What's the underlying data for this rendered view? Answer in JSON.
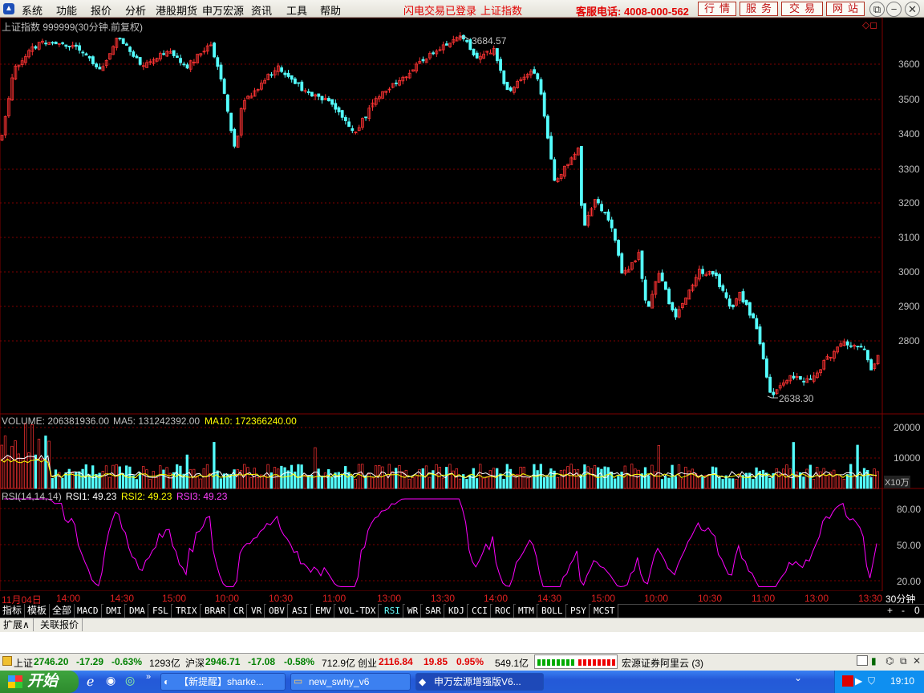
{
  "menu": [
    "系统",
    "功能",
    "报价",
    "分析",
    "港股期货",
    "申万宏源",
    "资讯",
    "工具",
    "帮助"
  ],
  "notice1": "闪电交易已登录",
  "notice2": "上证指数",
  "hotline": "客服电话: 4008-000-562",
  "topbuttons": [
    "行情",
    "服务",
    "交易",
    "网站"
  ],
  "chart_header": "上证指数 999999(30分钟.前复权)",
  "price_axis": [
    "3600",
    "3500",
    "3400",
    "3300",
    "3200",
    "3100",
    "3000",
    "2900",
    "2800"
  ],
  "high_label": "3684.57",
  "low_label": "2638.30",
  "volume": {
    "label": "VOLUME:",
    "value": "206381936.00",
    "ma5_label": "MA5:",
    "ma5": "131242392.00",
    "ma10_label": "MA10:",
    "ma10": "172366240.00",
    "axis": [
      "20000",
      "10000"
    ],
    "unit": "X10万"
  },
  "rsi": {
    "label": "RSI(14,14,14)",
    "rsi1": "RSI1: 49.23",
    "rsi2": "RSI2: 49.23",
    "rsi3": "RSI3: 49.23",
    "axis": [
      "80.00",
      "50.00",
      "20.00"
    ]
  },
  "time_axis": [
    "11月04日",
    "14:00",
    "14:30",
    "15:00",
    "10:00",
    "10:30",
    "11:00",
    "13:00",
    "13:30",
    "14:00",
    "14:30",
    "15:00",
    "10:00",
    "10:30",
    "11:00",
    "13:00",
    "13:30"
  ],
  "period": "30分钟",
  "tabs": [
    "指标",
    "模板",
    "全部",
    "MACD",
    "DMI",
    "DMA",
    "FSL",
    "TRIX",
    "BRAR",
    "CR",
    "VR",
    "OBV",
    "ASI",
    "EMV",
    "VOL-TDX",
    "RSI",
    "WR",
    "SAR",
    "KDJ",
    "CCI",
    "ROC",
    "MTM",
    "BOLL",
    "PSY",
    "MCST"
  ],
  "tab_controls": [
    "+",
    "-",
    "0"
  ],
  "ext_tabs": [
    "扩展∧",
    "关联报价"
  ],
  "status": {
    "sh_label": "上证",
    "sh_val": "2746.20",
    "sh_chg": "-17.29",
    "sh_pct": "-0.63%",
    "sh_amt": "1293亿",
    "hs_label": "沪深",
    "hs_val": "2946.71",
    "hs_chg": "-17.08",
    "hs_pct": "-0.58%",
    "hs_amt": "712.9亿",
    "cy_label": "创业",
    "cy_val": "2116.84",
    "cy_chg": "19.85",
    "cy_pct": "0.95%",
    "cy_amt": "549.1亿",
    "server": "宏源证券阿里云 (3)"
  },
  "taskbar": {
    "start": "开始",
    "tasks": [
      "【新提醒】sharke...",
      "new_swhy_v6",
      "申万宏源增强版V6..."
    ],
    "clock": "19:10"
  },
  "colors": {
    "up": "#ff3333",
    "down": "#54ffff",
    "grid": "#800000",
    "ma5": "#ffffff",
    "ma10": "#ffff00",
    "rsi": "#ff00ff"
  }
}
